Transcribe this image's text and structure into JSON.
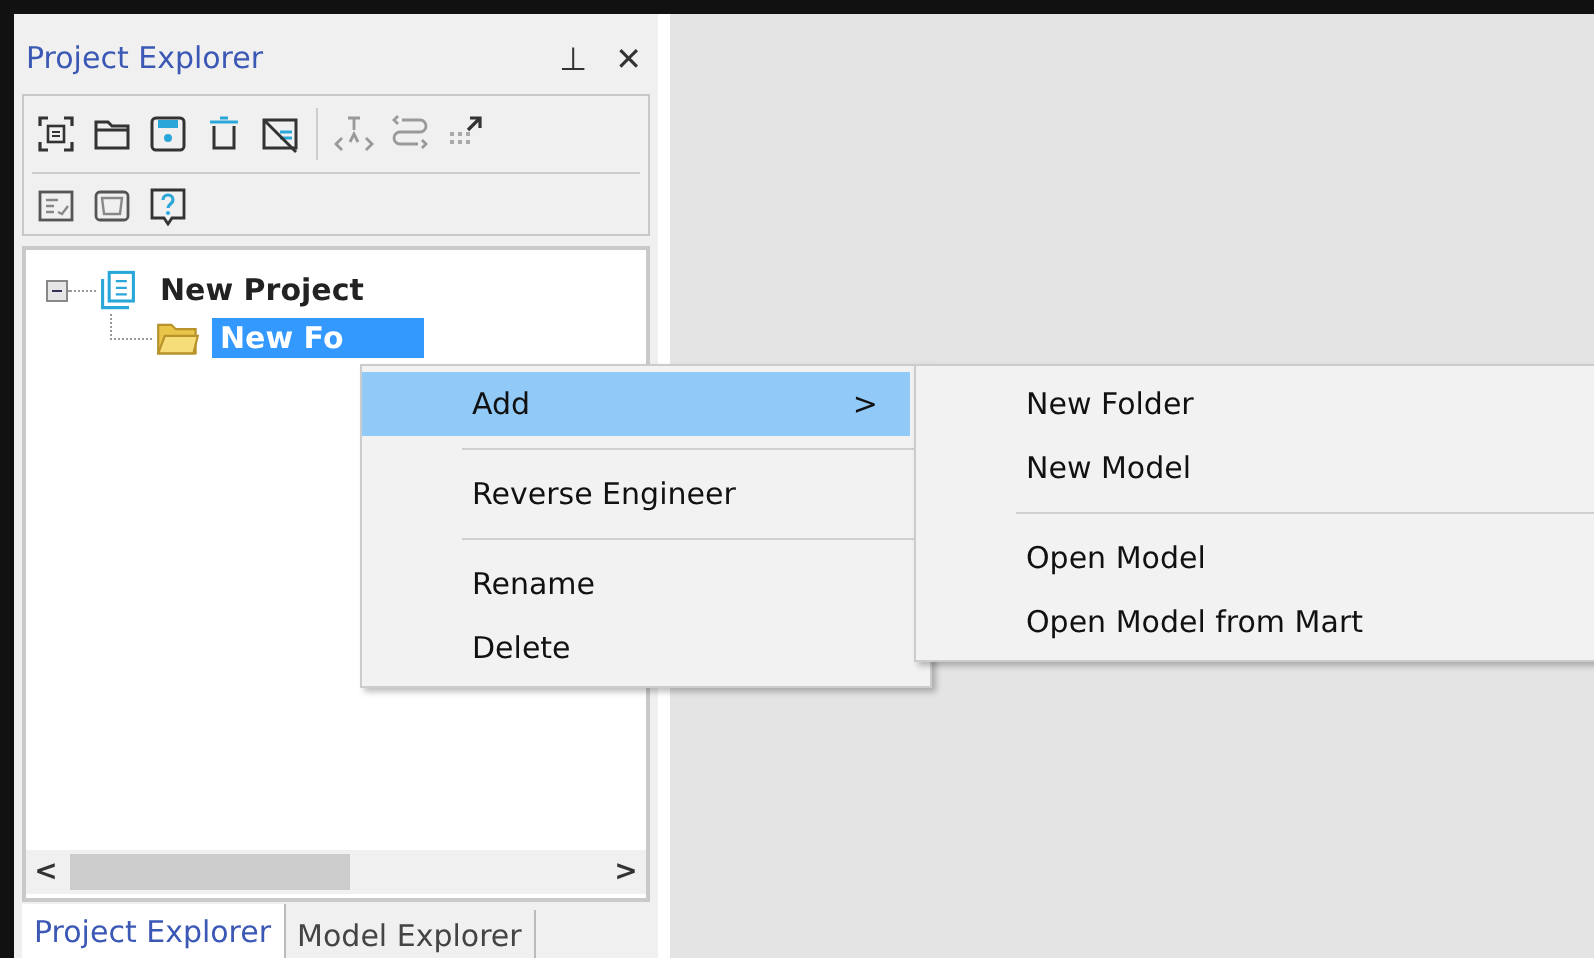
{
  "panel": {
    "title": "Project Explorer",
    "pin_glyph": "⊥",
    "close_glyph": "✕"
  },
  "tree": [
    {
      "label": "New Project",
      "expanded": true,
      "selected": false,
      "children": [
        {
          "label": "New Fo",
          "selected": true
        }
      ]
    }
  ],
  "scroll": {
    "left": "<",
    "right": ">"
  },
  "tabs": [
    {
      "label": "Project Explorer",
      "selected": true
    },
    {
      "label": "Model Explorer",
      "selected": false
    }
  ],
  "context_menu": [
    {
      "label": "Add",
      "submenu_arrow": ">",
      "selected": true,
      "separator_after": true
    },
    {
      "label": "Reverse Engineer",
      "selected": false,
      "separator_after": true
    },
    {
      "label": "Rename",
      "selected": false,
      "separator_after": false
    },
    {
      "label": "Delete",
      "selected": false,
      "separator_after": false
    }
  ],
  "submenu": [
    {
      "label": "New Folder",
      "separator_after": false
    },
    {
      "label": "New Model",
      "separator_after": true
    },
    {
      "label": "Open Model",
      "separator_after": false
    },
    {
      "label": "Open Model from Mart",
      "separator_after": false
    }
  ]
}
